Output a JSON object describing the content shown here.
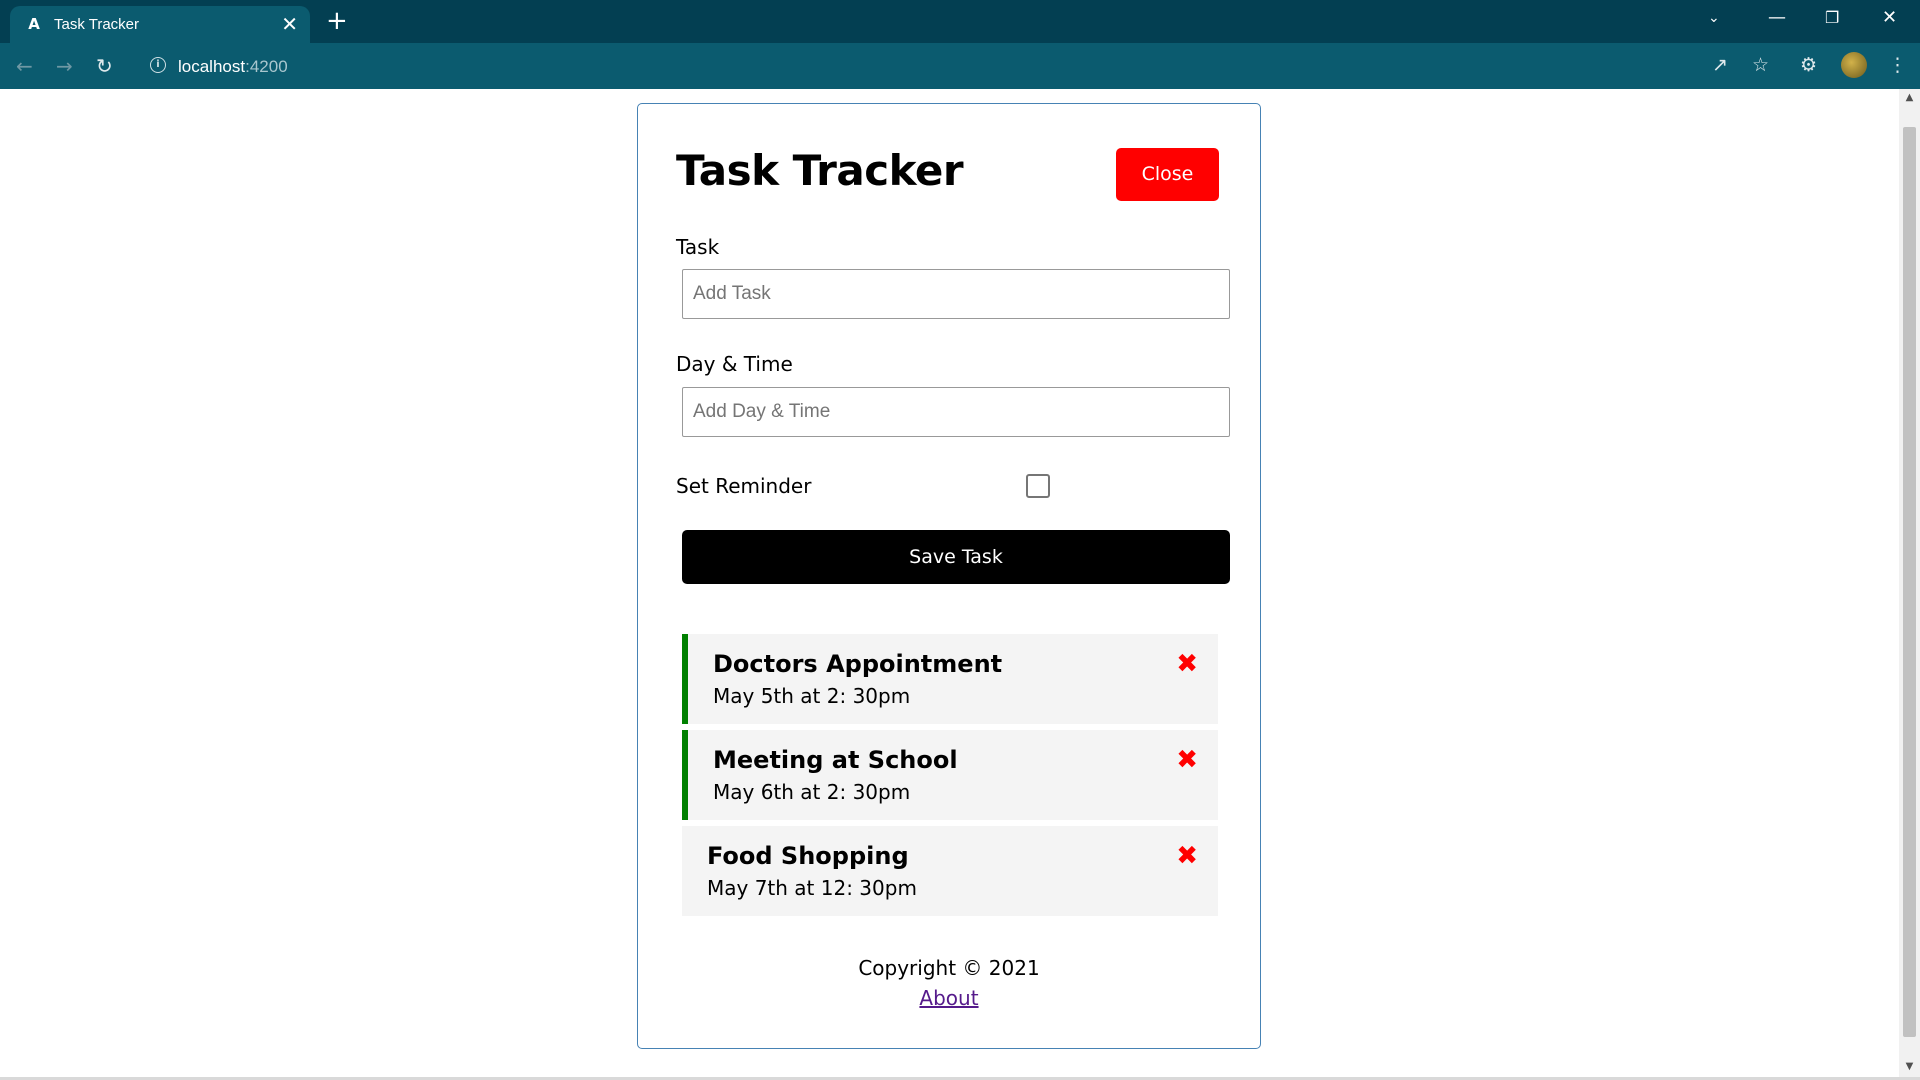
{
  "browser": {
    "tab_title": "Task Tracker",
    "tab_favicon": "A",
    "tab_close": "✕",
    "new_tab": "+",
    "url_host": "localhost",
    "url_port": ":4200",
    "icons": [
      "back-icon",
      "forward-icon",
      "reload-icon",
      "site-info-icon",
      "share-icon",
      "star-icon",
      "extensions-icon",
      "profile-avatar",
      "menu-icon"
    ]
  },
  "app": {
    "title": "Task Tracker",
    "close_label": "Close",
    "close_color": "#ff0000",
    "form": {
      "task_label": "Task",
      "task_placeholder": "Add Task",
      "task_value": "",
      "day_label": "Day & Time",
      "day_placeholder": "Add Day & Time",
      "day_value": "",
      "reminder_label": "Set Reminder",
      "reminder_checked": false,
      "save_label": "Save Task"
    },
    "tasks": [
      {
        "text": "Doctors Appointment",
        "day": "May 5th at 2: 30pm",
        "reminder": true
      },
      {
        "text": "Meeting at School",
        "day": "May 6th at 2: 30pm",
        "reminder": true
      },
      {
        "text": "Food Shopping",
        "day": "May 7th at 12: 30pm",
        "reminder": false
      }
    ],
    "delete_icon": "✖",
    "reminder_color": "#008000",
    "footer": {
      "copyright": "Copyright © 2021",
      "about_label": "About"
    }
  }
}
